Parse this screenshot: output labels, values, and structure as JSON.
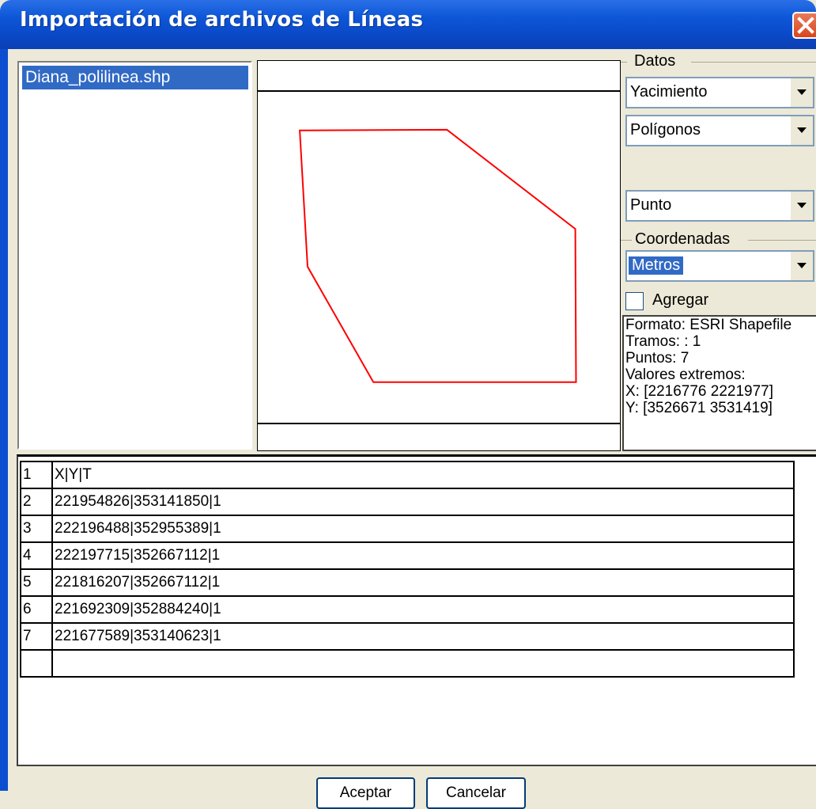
{
  "window": {
    "title": "Importación de archivos de Líneas"
  },
  "files": [
    "Diana_polilinea.shp"
  ],
  "preview": {
    "polygon_color": "#ff0000",
    "polygon_vertices": [
      [
        2219548.26,
        3531418.5
      ],
      [
        2221964.88,
        3529553.89
      ],
      [
        2221977.15,
        3526671.12
      ],
      [
        2218162.07,
        3526671.12
      ],
      [
        2216923.09,
        3528842.4
      ],
      [
        2216775.89,
        3531406.23
      ]
    ]
  },
  "datos": {
    "label": "Datos",
    "combo1": "Yacimiento",
    "combo2": "Polígonos",
    "combo3": "Punto"
  },
  "coordenadas": {
    "label": "Coordenadas",
    "combo": "Metros"
  },
  "agregar": {
    "label": "Agregar",
    "checked": false
  },
  "info": {
    "formato": "Formato: ESRI Shapefile",
    "tramos": "Tramos: : 1",
    "puntos": "Puntos: 7",
    "valores": "Valores extremos:",
    "x": "X: [2216776  2221977]",
    "y": "Y: [3526671  3531419]"
  },
  "grid": {
    "rows": [
      {
        "n": "1",
        "v": "X|Y|T"
      },
      {
        "n": "2",
        "v": "221954826|353141850|1"
      },
      {
        "n": "3",
        "v": "222196488|352955389|1"
      },
      {
        "n": "4",
        "v": "222197715|352667112|1"
      },
      {
        "n": "5",
        "v": "221816207|352667112|1"
      },
      {
        "n": "6",
        "v": "221692309|352884240|1"
      },
      {
        "n": "7",
        "v": "221677589|353140623|1"
      },
      {
        "n": "",
        "v": ""
      }
    ]
  },
  "buttons": {
    "ok": "Aceptar",
    "cancel": "Cancelar"
  }
}
